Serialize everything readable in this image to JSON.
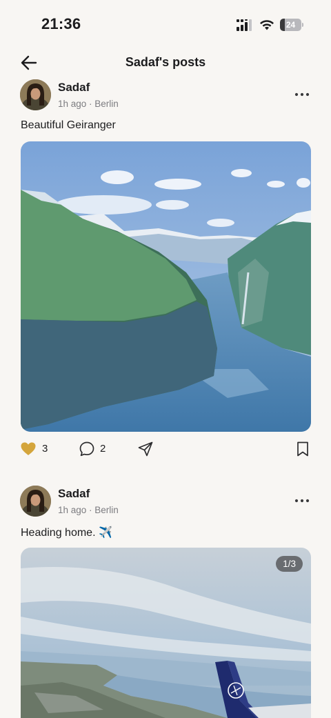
{
  "status_bar": {
    "time": "21:36",
    "battery_level": "24"
  },
  "header": {
    "back_icon": "arrow-left-icon",
    "title": "Sadaf's posts"
  },
  "posts": [
    {
      "author": "Sadaf",
      "meta": "1h ago · Berlin",
      "caption": "Beautiful Geiranger",
      "image_alt": "Geiranger fjord with snowy mountains",
      "likes": "3",
      "comments": "2",
      "liked": true
    },
    {
      "author": "Sadaf",
      "meta": "1h ago · Berlin",
      "caption": "Heading home. ✈️",
      "image_alt": "View from airplane window over coastline",
      "page_indicator": "1/3"
    }
  ],
  "colors": {
    "background": "#f8f6f3",
    "like_active": "#d4a53c",
    "text_primary": "#1c1c1e",
    "text_secondary": "#7c7c80"
  }
}
